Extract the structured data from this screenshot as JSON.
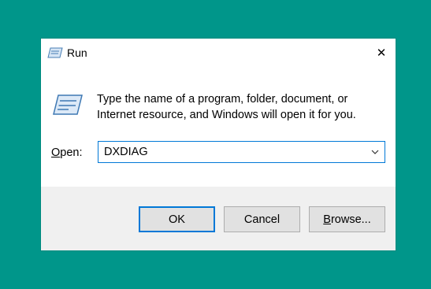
{
  "window": {
    "title": "Run",
    "close_glyph": "✕",
    "icon": "run-icon"
  },
  "prompt": {
    "line1": "Type the name of a program, folder, document, or",
    "line2": "Internet resource, and Windows will open it for you."
  },
  "open": {
    "label_mnemonic": "O",
    "label_rest": "pen:",
    "value": "DXDIAG"
  },
  "buttons": {
    "ok": "OK",
    "cancel": "Cancel",
    "browse_mnemonic": "B",
    "browse_rest": "rowse..."
  },
  "colors": {
    "background": "#00968a",
    "accent": "#0078d7",
    "footer": "#f0f0f0"
  }
}
